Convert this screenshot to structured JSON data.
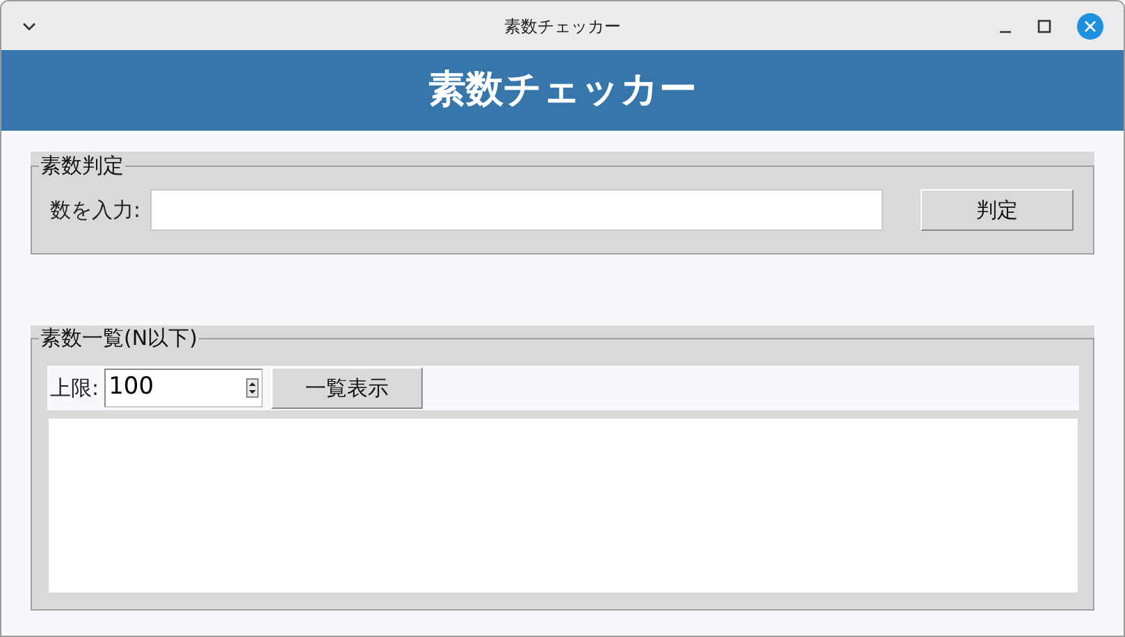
{
  "window": {
    "title": "素数チェッカー"
  },
  "header": {
    "title": "素数チェッカー"
  },
  "check_group": {
    "title": "素数判定",
    "label": "数を入力:",
    "button": "判定"
  },
  "list_group": {
    "title": "素数一覧(N以下)",
    "label": "上限:",
    "limit_value": "100",
    "button": "一覧表示"
  }
}
